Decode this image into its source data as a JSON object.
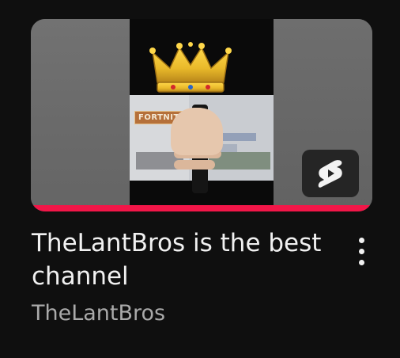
{
  "video": {
    "title": "TheLantBros is the best channel",
    "channel": "TheLantBros",
    "watch_progress": 1.0,
    "type": "shorts"
  },
  "thumbnail": {
    "game_label": "FORTNITE",
    "icon": "crown-icon"
  },
  "badge": {
    "icon": "youtube-shorts-icon"
  },
  "menu": {
    "icon": "more-vertical-icon"
  },
  "colors": {
    "background": "#0f0f0f",
    "progress": "#f21648",
    "title": "#f1f1f1",
    "channel": "#aaaaaa",
    "crown": "#e9b92a"
  }
}
